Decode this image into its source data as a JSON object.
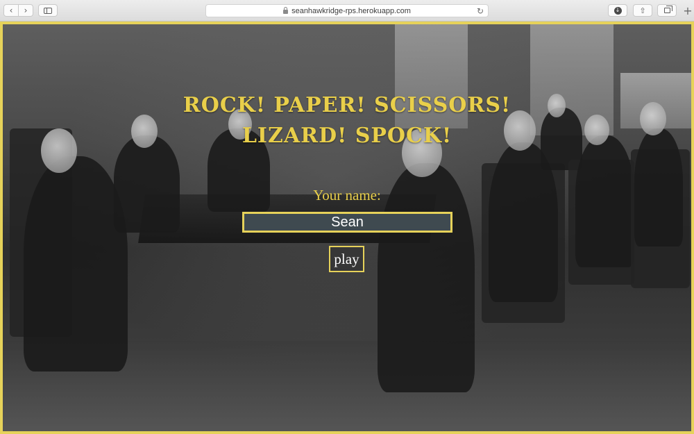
{
  "browser": {
    "url": "seanhawkridge-rps.herokuapp.com",
    "back_icon": "chevron-left-icon",
    "forward_icon": "chevron-right-icon",
    "sidebar_icon": "sidebar-icon",
    "download_icon": "download-icon",
    "share_icon": "share-icon",
    "tabs_icon": "tab-overview-icon",
    "new_tab_icon": "plus-icon"
  },
  "game": {
    "title_line1": "ROCK! PAPER! SCISSORS!",
    "title_line2": "LIZARD! SPOCK!",
    "name_label": "Your name:",
    "name_value": "Sean",
    "play_label": "play"
  },
  "colors": {
    "accent": "#e6d25a",
    "title_text": "#e9cf4a",
    "input_background": "#3f4a50"
  }
}
